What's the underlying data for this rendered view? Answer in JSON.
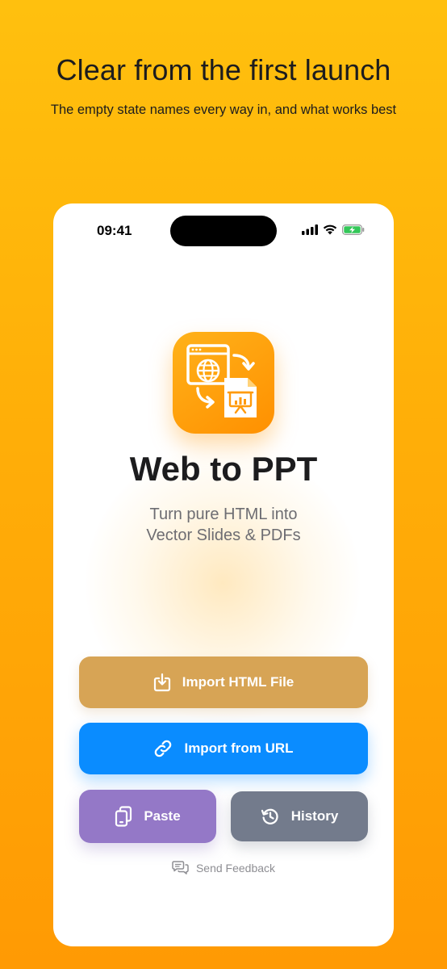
{
  "hero": {
    "title": "Clear from the first launch",
    "subtitle": "The empty state names every way in, and what works best"
  },
  "status_bar": {
    "time": "09:41",
    "icons": [
      "signal-icon",
      "wifi-icon",
      "battery-charging-icon"
    ]
  },
  "app": {
    "name": "Web to PPT",
    "tagline_line1": "Turn pure HTML into",
    "tagline_line2": "Vector Slides & PDFs",
    "icon": "web-to-slide-icon"
  },
  "actions": {
    "import_file": {
      "label": "Import HTML File",
      "icon": "download-tray-icon",
      "color": "#D7A455"
    },
    "import_url": {
      "label": "Import from URL",
      "icon": "link-icon",
      "color": "#0A8CFF"
    },
    "paste": {
      "label": "Paste",
      "icon": "clipboard-icon",
      "color": "#9478C7"
    },
    "history": {
      "label": "History",
      "icon": "history-icon",
      "color": "#737B8C"
    }
  },
  "feedback": {
    "label": "Send Feedback",
    "icon": "chat-bubbles-icon"
  },
  "colors": {
    "background_top": "#FFC00E",
    "background_bottom": "#FF9A04",
    "app_icon": "#FF9F10"
  }
}
